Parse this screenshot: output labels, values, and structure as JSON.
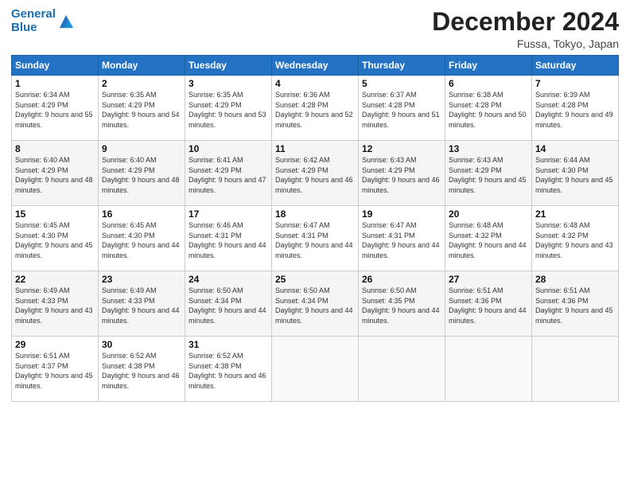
{
  "logo": {
    "line1": "General",
    "line2": "Blue"
  },
  "title": "December 2024",
  "location": "Fussa, Tokyo, Japan",
  "days_of_week": [
    "Sunday",
    "Monday",
    "Tuesday",
    "Wednesday",
    "Thursday",
    "Friday",
    "Saturday"
  ],
  "weeks": [
    [
      {
        "day": "1",
        "sunrise": "6:34 AM",
        "sunset": "4:29 PM",
        "daylight": "9 hours and 55 minutes."
      },
      {
        "day": "2",
        "sunrise": "6:35 AM",
        "sunset": "4:29 PM",
        "daylight": "9 hours and 54 minutes."
      },
      {
        "day": "3",
        "sunrise": "6:35 AM",
        "sunset": "4:29 PM",
        "daylight": "9 hours and 53 minutes."
      },
      {
        "day": "4",
        "sunrise": "6:36 AM",
        "sunset": "4:28 PM",
        "daylight": "9 hours and 52 minutes."
      },
      {
        "day": "5",
        "sunrise": "6:37 AM",
        "sunset": "4:28 PM",
        "daylight": "9 hours and 51 minutes."
      },
      {
        "day": "6",
        "sunrise": "6:38 AM",
        "sunset": "4:28 PM",
        "daylight": "9 hours and 50 minutes."
      },
      {
        "day": "7",
        "sunrise": "6:39 AM",
        "sunset": "4:28 PM",
        "daylight": "9 hours and 49 minutes."
      }
    ],
    [
      {
        "day": "8",
        "sunrise": "6:40 AM",
        "sunset": "4:29 PM",
        "daylight": "9 hours and 48 minutes."
      },
      {
        "day": "9",
        "sunrise": "6:40 AM",
        "sunset": "4:29 PM",
        "daylight": "9 hours and 48 minutes."
      },
      {
        "day": "10",
        "sunrise": "6:41 AM",
        "sunset": "4:29 PM",
        "daylight": "9 hours and 47 minutes."
      },
      {
        "day": "11",
        "sunrise": "6:42 AM",
        "sunset": "4:29 PM",
        "daylight": "9 hours and 46 minutes."
      },
      {
        "day": "12",
        "sunrise": "6:43 AM",
        "sunset": "4:29 PM",
        "daylight": "9 hours and 46 minutes."
      },
      {
        "day": "13",
        "sunrise": "6:43 AM",
        "sunset": "4:29 PM",
        "daylight": "9 hours and 45 minutes."
      },
      {
        "day": "14",
        "sunrise": "6:44 AM",
        "sunset": "4:30 PM",
        "daylight": "9 hours and 45 minutes."
      }
    ],
    [
      {
        "day": "15",
        "sunrise": "6:45 AM",
        "sunset": "4:30 PM",
        "daylight": "9 hours and 45 minutes."
      },
      {
        "day": "16",
        "sunrise": "6:45 AM",
        "sunset": "4:30 PM",
        "daylight": "9 hours and 44 minutes."
      },
      {
        "day": "17",
        "sunrise": "6:46 AM",
        "sunset": "4:31 PM",
        "daylight": "9 hours and 44 minutes."
      },
      {
        "day": "18",
        "sunrise": "6:47 AM",
        "sunset": "4:31 PM",
        "daylight": "9 hours and 44 minutes."
      },
      {
        "day": "19",
        "sunrise": "6:47 AM",
        "sunset": "4:31 PM",
        "daylight": "9 hours and 44 minutes."
      },
      {
        "day": "20",
        "sunrise": "6:48 AM",
        "sunset": "4:32 PM",
        "daylight": "9 hours and 44 minutes."
      },
      {
        "day": "21",
        "sunrise": "6:48 AM",
        "sunset": "4:32 PM",
        "daylight": "9 hours and 43 minutes."
      }
    ],
    [
      {
        "day": "22",
        "sunrise": "6:49 AM",
        "sunset": "4:33 PM",
        "daylight": "9 hours and 43 minutes."
      },
      {
        "day": "23",
        "sunrise": "6:49 AM",
        "sunset": "4:33 PM",
        "daylight": "9 hours and 44 minutes."
      },
      {
        "day": "24",
        "sunrise": "6:50 AM",
        "sunset": "4:34 PM",
        "daylight": "9 hours and 44 minutes."
      },
      {
        "day": "25",
        "sunrise": "6:50 AM",
        "sunset": "4:34 PM",
        "daylight": "9 hours and 44 minutes."
      },
      {
        "day": "26",
        "sunrise": "6:50 AM",
        "sunset": "4:35 PM",
        "daylight": "9 hours and 44 minutes."
      },
      {
        "day": "27",
        "sunrise": "6:51 AM",
        "sunset": "4:36 PM",
        "daylight": "9 hours and 44 minutes."
      },
      {
        "day": "28",
        "sunrise": "6:51 AM",
        "sunset": "4:36 PM",
        "daylight": "9 hours and 45 minutes."
      }
    ],
    [
      {
        "day": "29",
        "sunrise": "6:51 AM",
        "sunset": "4:37 PM",
        "daylight": "9 hours and 45 minutes."
      },
      {
        "day": "30",
        "sunrise": "6:52 AM",
        "sunset": "4:38 PM",
        "daylight": "9 hours and 46 minutes."
      },
      {
        "day": "31",
        "sunrise": "6:52 AM",
        "sunset": "4:38 PM",
        "daylight": "9 hours and 46 minutes."
      },
      null,
      null,
      null,
      null
    ]
  ]
}
